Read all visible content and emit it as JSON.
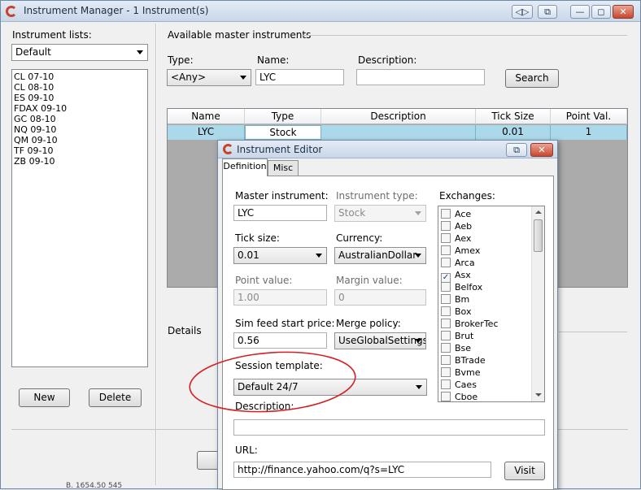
{
  "main": {
    "title": "Instrument Manager - 1 Instrument(s)",
    "titlebar_buttons": [
      "◁▷",
      "⧉",
      "—",
      "◻",
      "✕"
    ],
    "instrument_lists_label": "Instrument lists:",
    "instrument_lists_selected": "Default",
    "instrument_list": [
      "CL 07-10",
      "CL 08-10",
      "ES 09-10",
      "FDAX 09-10",
      "GC 08-10",
      "NQ 09-10",
      "QM 09-10",
      "TF 09-10",
      "ZB 09-10"
    ],
    "new_button": "New",
    "delete_button": "Delete",
    "available_label": "Available master instruments",
    "type_label": "Type:",
    "type_value": "<Any>",
    "name_label": "Name:",
    "name_value": "LYC",
    "description_label": "Description:",
    "description_value": "",
    "search_button": "Search",
    "grid": {
      "headers": [
        "Name",
        "Type",
        "Description",
        "Tick Size",
        "Point Val."
      ],
      "rows": [
        [
          "LYC",
          "Stock",
          "",
          "0.01",
          "1"
        ]
      ]
    },
    "details_label": "Details",
    "background_text": "B. 1654.50        545"
  },
  "editor": {
    "title": "Instrument Editor",
    "titlebar_buttons": [
      "⧉",
      "✕"
    ],
    "tabs": [
      "Definition",
      "Misc"
    ],
    "master_instrument_label": "Master instrument:",
    "master_instrument_value": "LYC",
    "instrument_type_label": "Instrument type:",
    "instrument_type_value": "Stock",
    "tick_size_label": "Tick size:",
    "tick_size_value": "0.01",
    "currency_label": "Currency:",
    "currency_value": "AustralianDollar",
    "point_value_label": "Point value:",
    "point_value_value": "1.00",
    "margin_value_label": "Margin value:",
    "margin_value_value": "0",
    "sim_feed_label": "Sim feed start price:",
    "sim_feed_value": "0.56",
    "merge_policy_label": "Merge policy:",
    "merge_policy_value": "UseGlobalSettings",
    "session_template_label": "Session template:",
    "session_template_value": "Default 24/7",
    "description_label": "Description:",
    "description_value": "",
    "url_label": "URL:",
    "url_value": "http://finance.yahoo.com/q?s=LYC",
    "visit_button": "Visit",
    "exchanges_label": "Exchanges:",
    "exchanges": [
      {
        "name": "Ace",
        "checked": false
      },
      {
        "name": "Aeb",
        "checked": false
      },
      {
        "name": "Aex",
        "checked": false
      },
      {
        "name": "Amex",
        "checked": false
      },
      {
        "name": "Arca",
        "checked": false
      },
      {
        "name": "Asx",
        "checked": true
      },
      {
        "name": "Belfox",
        "checked": false
      },
      {
        "name": "Bm",
        "checked": false
      },
      {
        "name": "Box",
        "checked": false
      },
      {
        "name": "BrokerTec",
        "checked": false
      },
      {
        "name": "Brut",
        "checked": false
      },
      {
        "name": "Bse",
        "checked": false
      },
      {
        "name": "BTrade",
        "checked": false
      },
      {
        "name": "Bvme",
        "checked": false
      },
      {
        "name": "Caes",
        "checked": false
      },
      {
        "name": "Cboe",
        "checked": false
      }
    ],
    "check_mark": "✓"
  },
  "annotation": {
    "ellipse_color": "#d42020"
  }
}
